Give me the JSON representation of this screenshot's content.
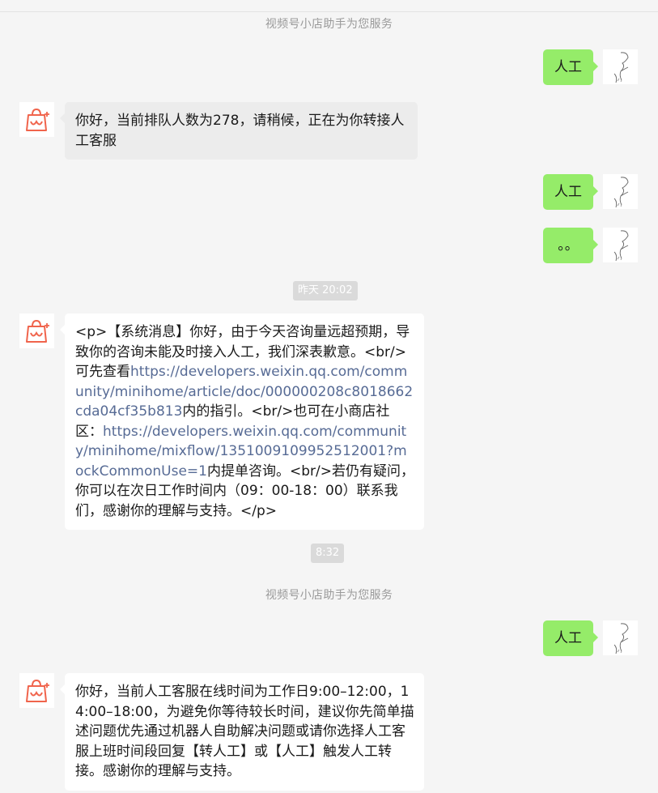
{
  "header": {
    "service_note": "视频号小店助手为您服务"
  },
  "messages": {
    "m1": {
      "text": "人工"
    },
    "m2": {
      "text": "你好，当前排队人数为278，请稍候，正在为你转接人工客服"
    },
    "m3": {
      "text": "人工"
    },
    "m4": {
      "text": "。。"
    },
    "t1": {
      "text": "昨天 20:02"
    },
    "m5": {
      "p1": "<p>【系统消息】你好，由于今天咨询量远超预期，导致你的咨询未能及时接入人工，我们深表歉意。<br/>可先查看",
      "link1": "https://developers.weixin.qq.com/community/minihome/article/doc/000000208c8018662cda04cf35b813",
      "p2": "内的指引。<br/>也可在小商店社区：",
      "link2": "https://developers.weixin.qq.com/community/minihome/mixflow/1351009109952512001?mockCommonUse=1",
      "p3": "内提单咨询。<br/>若仍有疑问，你可以在次日工作时间内（09：00-18：00）联系我们，感谢你的理解与支持。</p>"
    },
    "t2": {
      "text": "8:32"
    },
    "service_note_2": "视频号小店助手为您服务",
    "m6": {
      "text": "人工"
    },
    "m7": {
      "text": "你好，当前人工客服在线时间为工作日9:00–12:00，14:00–18:00，为避免你等待较长时间，建议你先简单描述问题优先通过机器人自助解决问题或请你选择人工客服上班时间段回复【转人工】或【人工】触发人工转接。感谢你的理解与支持。"
    }
  },
  "colors": {
    "outgoing_bubble": "#95ec69",
    "link": "#576b95",
    "brand_icon": "#f0644c"
  },
  "icons": {
    "bot_avatar": "shop-bag-icon",
    "user_avatar": "sketch-face-avatar"
  }
}
